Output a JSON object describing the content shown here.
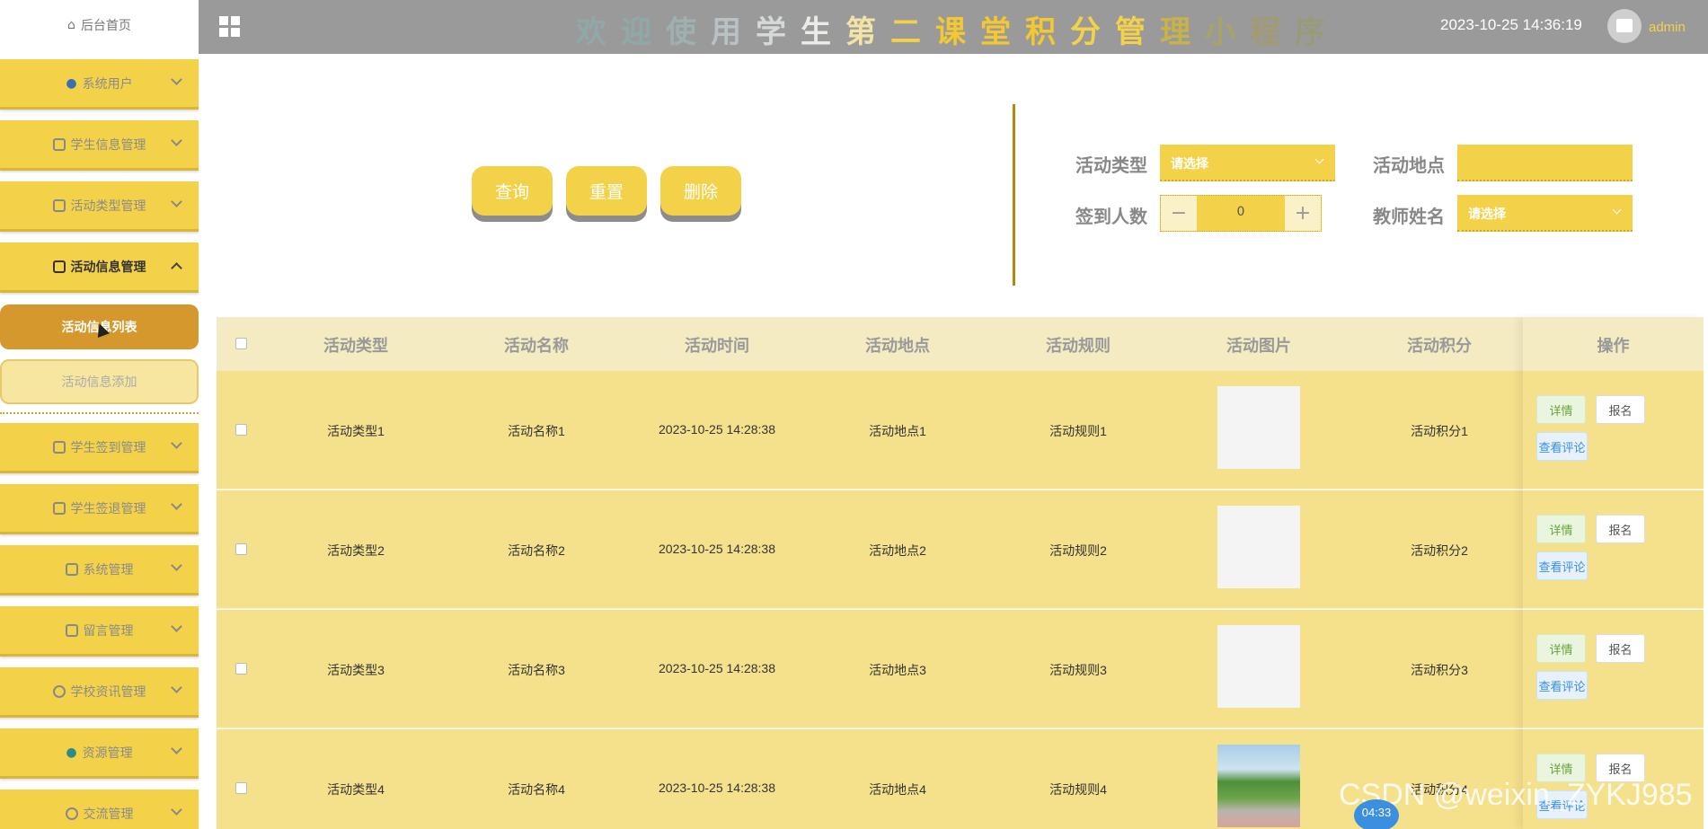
{
  "header": {
    "title": "欢迎使用学生第二课堂积分管理小程序",
    "datetime": "2023-10-25 14:36:19",
    "user": "admin",
    "menu_icon": "grid-icon"
  },
  "sidebar": {
    "home": "后台首页",
    "items": [
      {
        "label": "系统用户",
        "icon": "user-icon"
      },
      {
        "label": "学生信息管理",
        "icon": "edit-icon"
      },
      {
        "label": "活动类型管理",
        "icon": "edit-icon"
      },
      {
        "label": "活动信息管理",
        "icon": "edit-icon",
        "open": true
      },
      {
        "label": "学生签到管理",
        "icon": "edit-icon"
      },
      {
        "label": "学生签退管理",
        "icon": "edit-icon"
      },
      {
        "label": "系统管理",
        "icon": "image-icon"
      },
      {
        "label": "留言管理",
        "icon": "image-icon"
      },
      {
        "label": "学校资讯管理",
        "icon": "info-icon"
      },
      {
        "label": "资源管理",
        "icon": "location-icon"
      },
      {
        "label": "交流管理",
        "icon": "chat-icon"
      }
    ],
    "sub_items": [
      {
        "label": "活动信息列表",
        "active": true
      },
      {
        "label": "活动信息添加",
        "active": false
      }
    ]
  },
  "search": {
    "buttons": {
      "query": "查询",
      "reset": "重置",
      "delete": "删除"
    },
    "fields": {
      "type_label": "活动类型",
      "type_placeholder": "请选择",
      "location_label": "活动地点",
      "location_value": "",
      "checkin_label": "签到人数",
      "checkin_value": "0",
      "teacher_label": "教师姓名",
      "teacher_placeholder": "请选择"
    }
  },
  "table": {
    "headers": [
      "活动类型",
      "活动名称",
      "活动时间",
      "活动地点",
      "活动规则",
      "活动图片",
      "活动积分",
      "操作"
    ],
    "rows": [
      {
        "type": "活动类型1",
        "name": "活动名称1",
        "time": "2023-10-25 14:28:38",
        "location": "活动地点1",
        "rule": "活动规则1",
        "points": "活动积分1"
      },
      {
        "type": "活动类型2",
        "name": "活动名称2",
        "time": "2023-10-25 14:28:38",
        "location": "活动地点2",
        "rule": "活动规则2",
        "points": "活动积分2"
      },
      {
        "type": "活动类型3",
        "name": "活动名称3",
        "time": "2023-10-25 14:28:38",
        "location": "活动地点3",
        "rule": "活动规则3",
        "points": "活动积分3"
      },
      {
        "type": "活动类型4",
        "name": "活动名称4",
        "time": "2023-10-25 14:28:38",
        "location": "活动地点4",
        "rule": "活动规则4",
        "points": "活动积分4"
      }
    ],
    "actions": {
      "detail": "详情",
      "join": "报名",
      "comment": "查看评论"
    }
  },
  "overlay": {
    "watermark": "CSDN @weixin_ZYKJ985",
    "timer": "04:33"
  },
  "colors": {
    "accent": "#f3d24a",
    "active_sub": "#d4982c",
    "header_bg": "#9a9a9a"
  }
}
